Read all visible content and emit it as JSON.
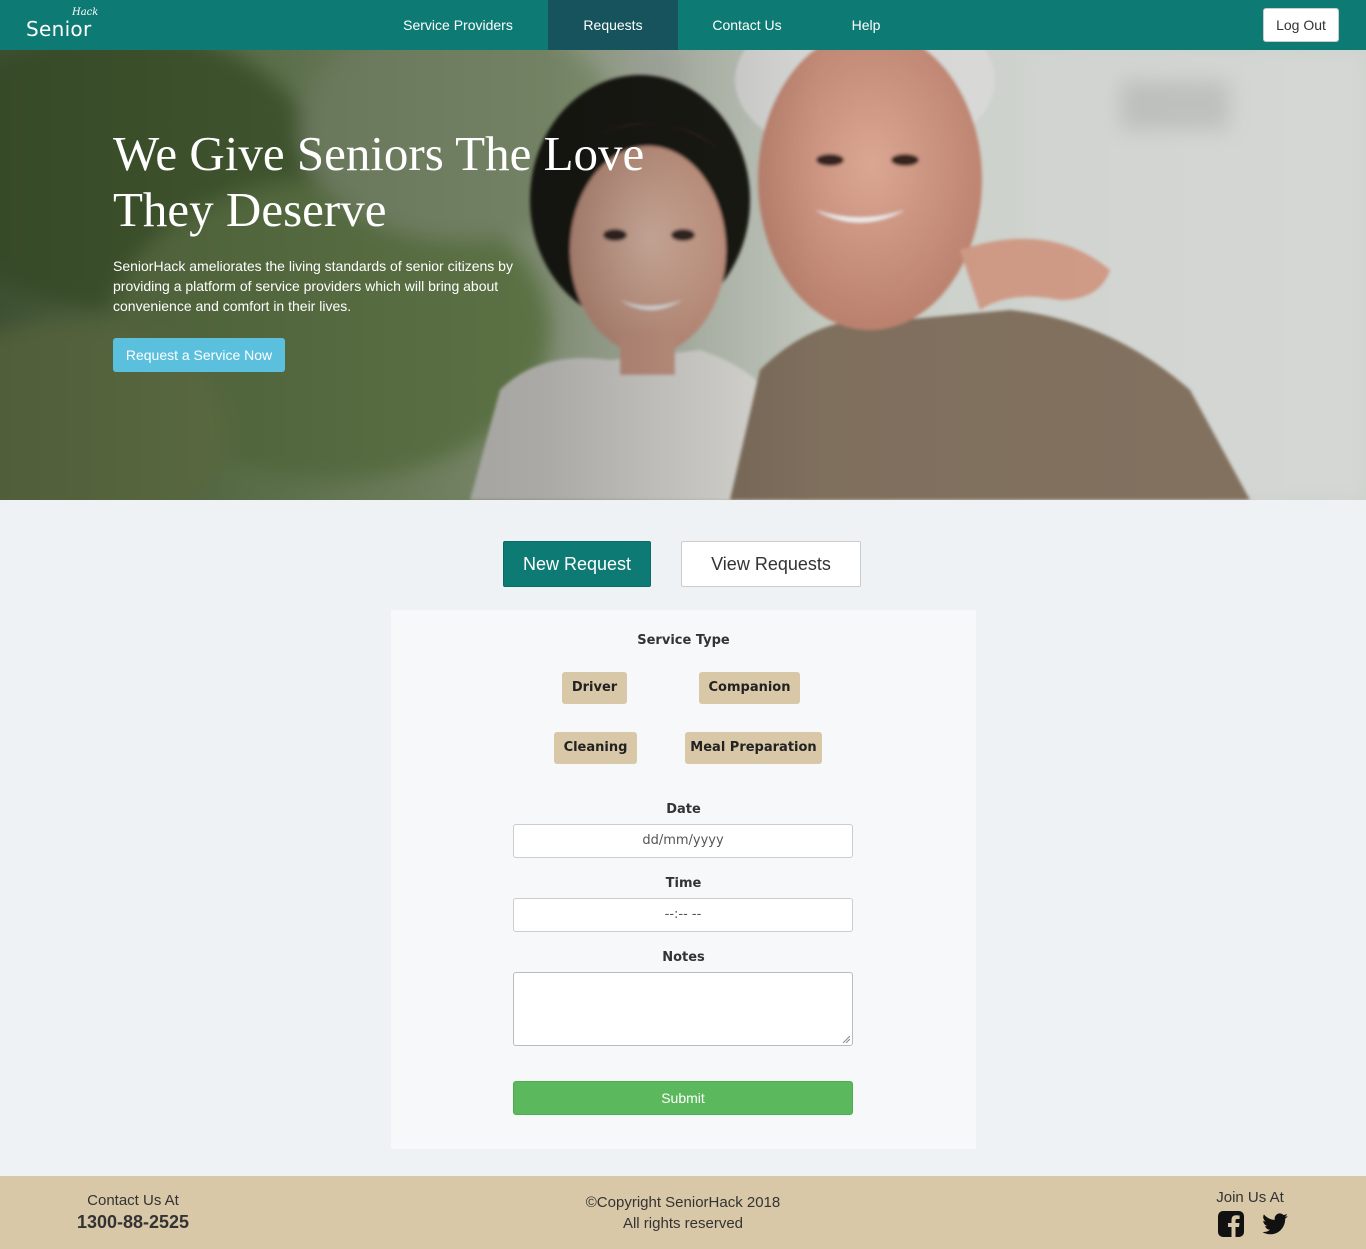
{
  "brand": {
    "name": "Senior",
    "superscript": "Hack"
  },
  "nav": {
    "links": [
      {
        "label": "Service Providers"
      },
      {
        "label": "Requests"
      },
      {
        "label": "Contact Us"
      },
      {
        "label": "Help"
      }
    ],
    "active": "Requests",
    "logout_label": "Log Out"
  },
  "hero": {
    "title": "We Give Seniors The Love They Deserve",
    "description": "SeniorHack ameliorates the living standards of senior citizens by providing a platform of service providers which will bring about convenience and comfort in their lives.",
    "cta_label": "Request a Service Now"
  },
  "tabs": {
    "new_request": "New Request",
    "view_requests": "View Requests"
  },
  "form": {
    "service_type_label": "Service Type",
    "service_types": [
      "Driver",
      "Companion",
      "Cleaning",
      "Meal Preparation"
    ],
    "date_label": "Date",
    "date_placeholder": "dd/mm/yyyy",
    "time_label": "Time",
    "time_placeholder": "--:-- --",
    "notes_label": "Notes",
    "notes_value": "",
    "submit_label": "Submit"
  },
  "footer": {
    "contact_label": "Contact Us At",
    "phone": "1300-88-2525",
    "copyright": "©Copyright SeniorHack 2018",
    "rights": "All rights reserved",
    "join_label": "Join Us At",
    "social_icons": [
      "facebook-icon",
      "twitter-icon"
    ]
  },
  "colors": {
    "primary": "#0e7a74",
    "nav_active": "#16535c",
    "hero_button": "#5bc0de",
    "chip": "#d8c8a8",
    "submit": "#5cb85c",
    "footer": "#d8c8a8"
  }
}
